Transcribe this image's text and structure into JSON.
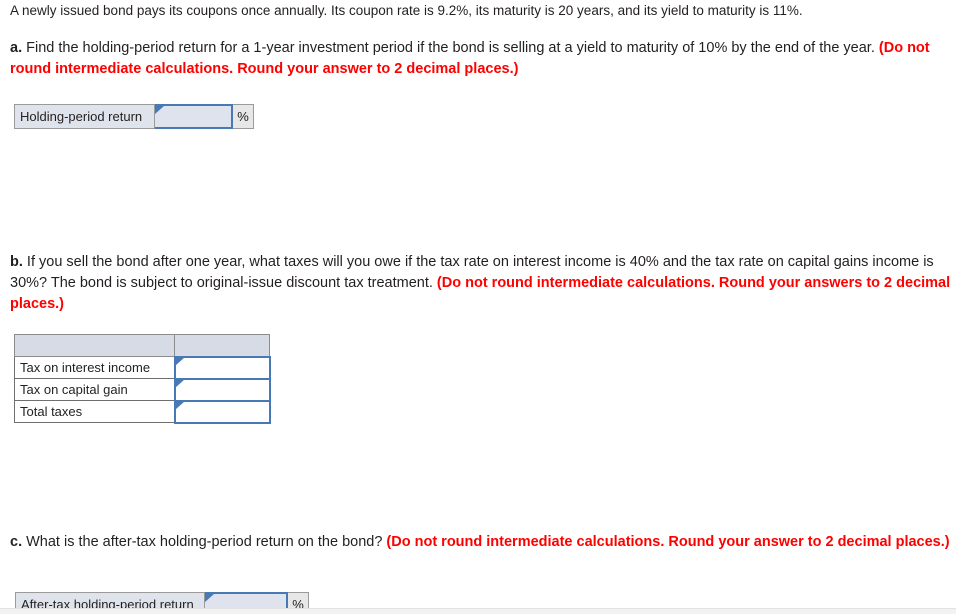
{
  "problem": {
    "intro": "A newly issued bond pays its coupons once annually. Its coupon rate is 9.2%, its maturity is 20 years, and its yield to maturity is 11%."
  },
  "parts": {
    "a": {
      "label": "a.",
      "question": " Find the holding-period return for a 1-year investment period if the bond is selling at a yield to maturity of 10% by the end of the year. ",
      "instruction": "(Do not round intermediate calculations. Round your answer to 2 decimal places.)",
      "answer_label": "Holding-period return",
      "answer_value": "",
      "unit": "%"
    },
    "b": {
      "label": "b.",
      "question": " If you sell the bond after one year, what taxes will you owe if the tax rate on interest income is 40% and the tax rate on capital gains income is 30%? The bond is subject to original-issue discount tax treatment. ",
      "instruction": "(Do not round intermediate calculations. Round your answers to 2 decimal places.)",
      "table": {
        "header": [
          "",
          ""
        ],
        "rows": [
          {
            "label": "Tax on interest income",
            "value": ""
          },
          {
            "label": "Tax on capital gain",
            "value": ""
          },
          {
            "label": "Total taxes",
            "value": ""
          }
        ]
      }
    },
    "c": {
      "label": "c.",
      "question": " What is the after-tax holding-period return on the bond? ",
      "instruction": "(Do not round intermediate calculations. Round your answer to 2 decimal places.)",
      "answer_label": "After-tax holding-period return",
      "answer_value": "",
      "unit": "%"
    }
  },
  "colors": {
    "instruction_red": "#ff0000",
    "input_border_blue": "#4879b5",
    "input_fill_blue": "#dee3ee",
    "label_fill_gray": "#dfe3ec",
    "table_header_fill": "#d6dbe6"
  }
}
